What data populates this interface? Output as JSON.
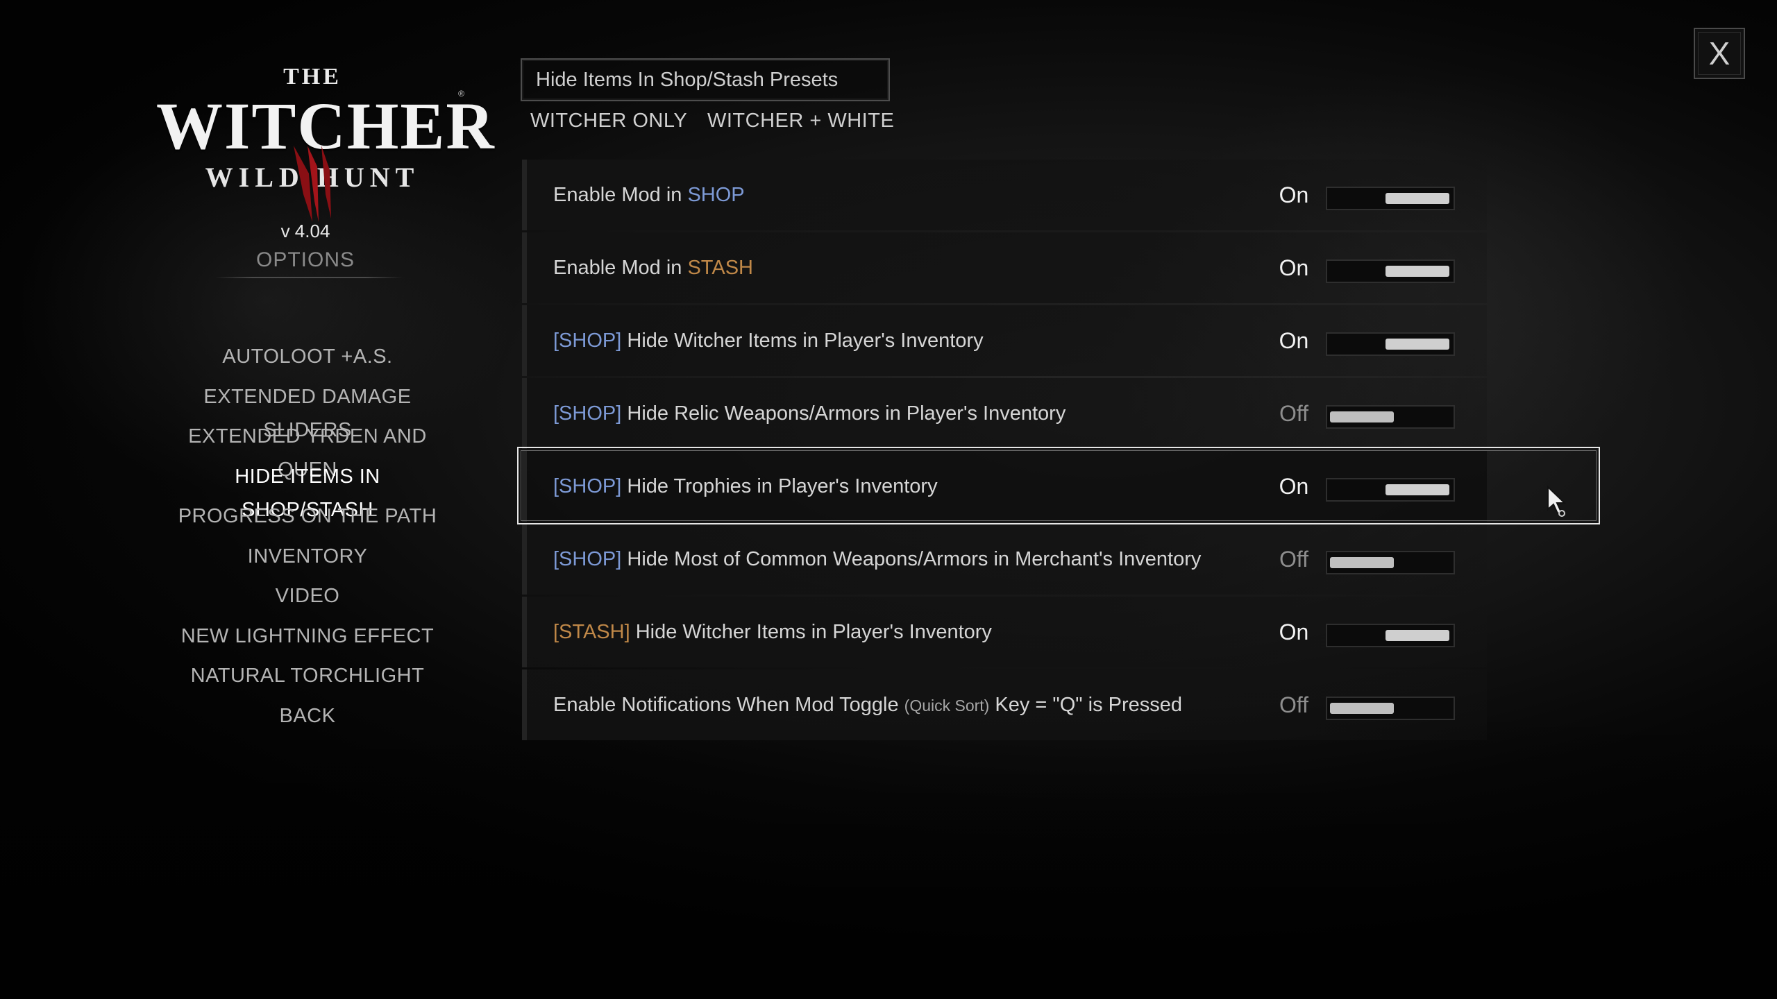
{
  "logo": {
    "the": "THE",
    "title": "WITCHER",
    "subtitle": "WILD HUNT",
    "reg": "®"
  },
  "version": "v 4.04",
  "options_title": "OPTIONS",
  "nav": {
    "items": [
      {
        "label": "AUTOLOOT +A.S."
      },
      {
        "label": "EXTENDED DAMAGE SLIDERS"
      },
      {
        "label": "EXTENDED YRDEN AND QUEN"
      },
      {
        "label": "HIDE ITEMS IN SHOP/STASH"
      },
      {
        "label": "PROGRESS ON THE PATH"
      },
      {
        "label": "INVENTORY"
      },
      {
        "label": "VIDEO"
      },
      {
        "label": "NEW LIGHTNING EFFECT"
      },
      {
        "label": "NATURAL TORCHLIGHT"
      },
      {
        "label": "BACK"
      }
    ],
    "active_index": 3
  },
  "presets": {
    "title": "Hide Items In Shop/Stash Presets",
    "buttons": [
      "WITCHER ONLY",
      "WITCHER + WHITE"
    ]
  },
  "rows": [
    {
      "prefix": "Enable Mod in ",
      "highlight": "SHOP",
      "state": "On"
    },
    {
      "prefix": "Enable Mod in ",
      "highlight": "STASH",
      "state": "On"
    },
    {
      "tag": "[SHOP]",
      "label": "Hide Witcher Items in Player's Inventory",
      "state": "On"
    },
    {
      "tag": "[SHOP]",
      "label": "Hide Relic Weapons/Armors in Player's Inventory",
      "state": "Off"
    },
    {
      "tag": "[SHOP]",
      "label": "Hide Trophies in Player's Inventory",
      "state": "On"
    },
    {
      "tag": "[SHOP]",
      "label": "Hide Most of Common Weapons/Armors in Merchant's Inventory",
      "state": "Off"
    },
    {
      "tag": "[STASH]",
      "label": "Hide Witcher Items in Player's Inventory",
      "state": "On"
    },
    {
      "part1": "Enable Notifications When Mod Toggle ",
      "small": "(Quick Sort)",
      "part2": " Key = \"Q\" is Pressed",
      "state": "Off"
    }
  ],
  "selected_row": 4,
  "close_label": "X",
  "colors": {
    "shop_tag": "#7d9ad6",
    "stash_tag": "#c08848",
    "background": "#151515",
    "selection_frame": "#e6e6e6"
  },
  "icons": {
    "close": "close-icon",
    "cursor": "mouse-pointer-icon",
    "logo_mark": "witcher-logo-mark-icon"
  }
}
